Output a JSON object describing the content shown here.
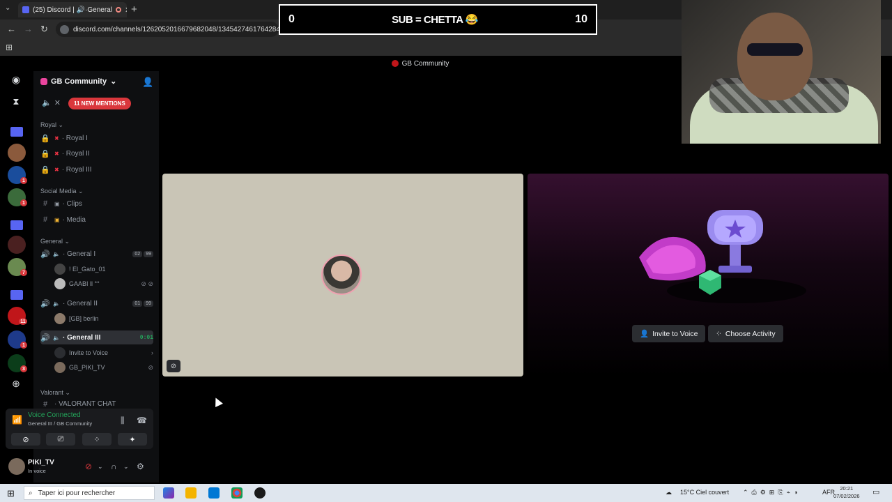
{
  "browser": {
    "tab_title": "(25) Discord | 🔊·General",
    "url": "discord.com/channels/1262052016679682048/1345427461764284477"
  },
  "overlay": {
    "left": "0",
    "center": "SUB = CHETTA 😂",
    "right": "10"
  },
  "discord": {
    "window_title": "GB Community",
    "server_name": "GB Community",
    "mentions_label": "11 NEW MENTIONS",
    "rail_badges": [
      "1",
      "1",
      "7",
      "11",
      "1",
      "3"
    ],
    "categories": {
      "royal": "Royal",
      "social": "Social Media",
      "general": "General",
      "valorant": "Valorant"
    },
    "royal_channels": [
      "· Royal I",
      "· Royal II",
      "· Royal III"
    ],
    "social_channels": [
      "· Clips",
      "· Media"
    ],
    "general1": {
      "name": "· General I",
      "counts": [
        "02",
        "99"
      ]
    },
    "general1_users": [
      "! El_Gato_01",
      "GAABI ll °°"
    ],
    "general2": {
      "name": "· General II",
      "counts": [
        "01",
        "99"
      ]
    },
    "general2_users": [
      "[GB] berlin"
    ],
    "general3": {
      "name": "· General III",
      "timer": "0:01"
    },
    "general3_invite": "Invite to Voice",
    "general3_users": [
      "GB_PIKI_TV"
    ],
    "valorant_partial": "· VALORANT CHAT"
  },
  "voice_panel": {
    "status": "Voice Connected",
    "channel": "General III / GB Community"
  },
  "user_panel": {
    "name": "PIKI_TV",
    "status": "In voice"
  },
  "stage": {
    "invite_button": "Invite to Voice",
    "activity_button": "Choose Activity"
  },
  "taskbar": {
    "search_placeholder": "Taper ici pour rechercher",
    "weather": "15°C  Ciel couvert",
    "lang": "AFR",
    "time": "20:21",
    "date": "07/02/2026"
  },
  "colors": {
    "accent_green": "#23a55a",
    "mention_red": "#da373c",
    "blurple": "#5865f2"
  }
}
